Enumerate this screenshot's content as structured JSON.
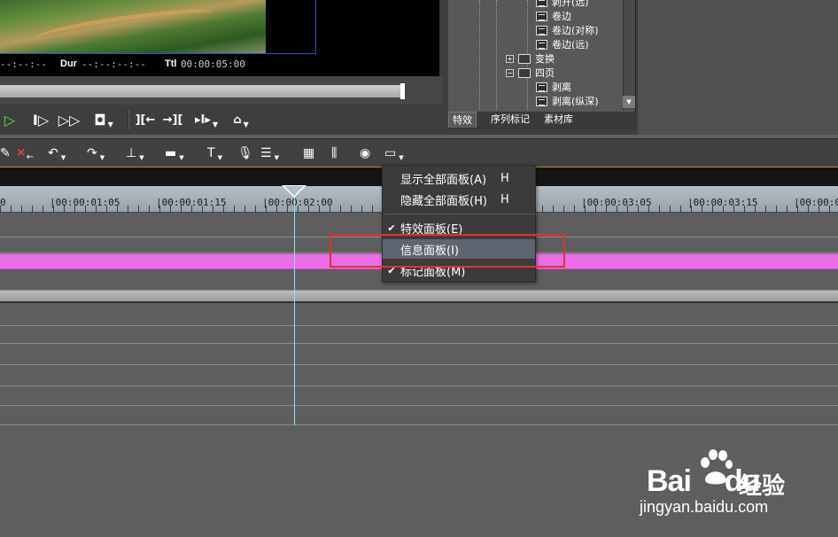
{
  "preview": {
    "in_label": "--:--:--",
    "dur_label": "Dur",
    "dur_value": "--:--:--:--",
    "ttl_label": "Ttl",
    "ttl_value": "00:00:05:00"
  },
  "effects_tree": {
    "items": [
      {
        "kind": "effect",
        "label": "剥开(远)"
      },
      {
        "kind": "effect",
        "label": "卷边"
      },
      {
        "kind": "effect",
        "label": "卷边(对称)"
      },
      {
        "kind": "effect",
        "label": "卷边(远)"
      },
      {
        "kind": "folder",
        "label": "变换",
        "expander": "+"
      },
      {
        "kind": "folder",
        "label": "四页",
        "expander": "−"
      },
      {
        "kind": "effect",
        "label": "剥离"
      },
      {
        "kind": "effect",
        "label": "剥离(纵深)"
      }
    ],
    "tabs": [
      "特效",
      "序列标记",
      "素材库"
    ]
  },
  "ruler": {
    "labels": [
      "0",
      "|00:00:01:05",
      "|00:00:01:15",
      "|00:00:02:00",
      "|00:00:03:05",
      "|00:00:03:15",
      "|00:00:04"
    ]
  },
  "context_menu": {
    "items": [
      {
        "label": "显示全部面板(A)",
        "shortcut": "H",
        "checked": false
      },
      {
        "label": "隐藏全部面板(H)",
        "shortcut": "H",
        "checked": false
      },
      {
        "label": "特效面板(E)",
        "shortcut": "",
        "checked": true
      },
      {
        "label": "信息面板(I)",
        "shortcut": "",
        "checked": false
      },
      {
        "label": "标记面板(M)",
        "shortcut": "",
        "checked": true
      }
    ]
  },
  "watermark": {
    "logo": "Bai",
    "logo_suffix": "du",
    "cn": "经验",
    "url": "jingyan.baidu.com"
  },
  "colors": {
    "highlight": "#e2303a",
    "clip": "#ea6fe6",
    "playhead": "#7fe7ff",
    "play_green": "#6fdc3a"
  }
}
